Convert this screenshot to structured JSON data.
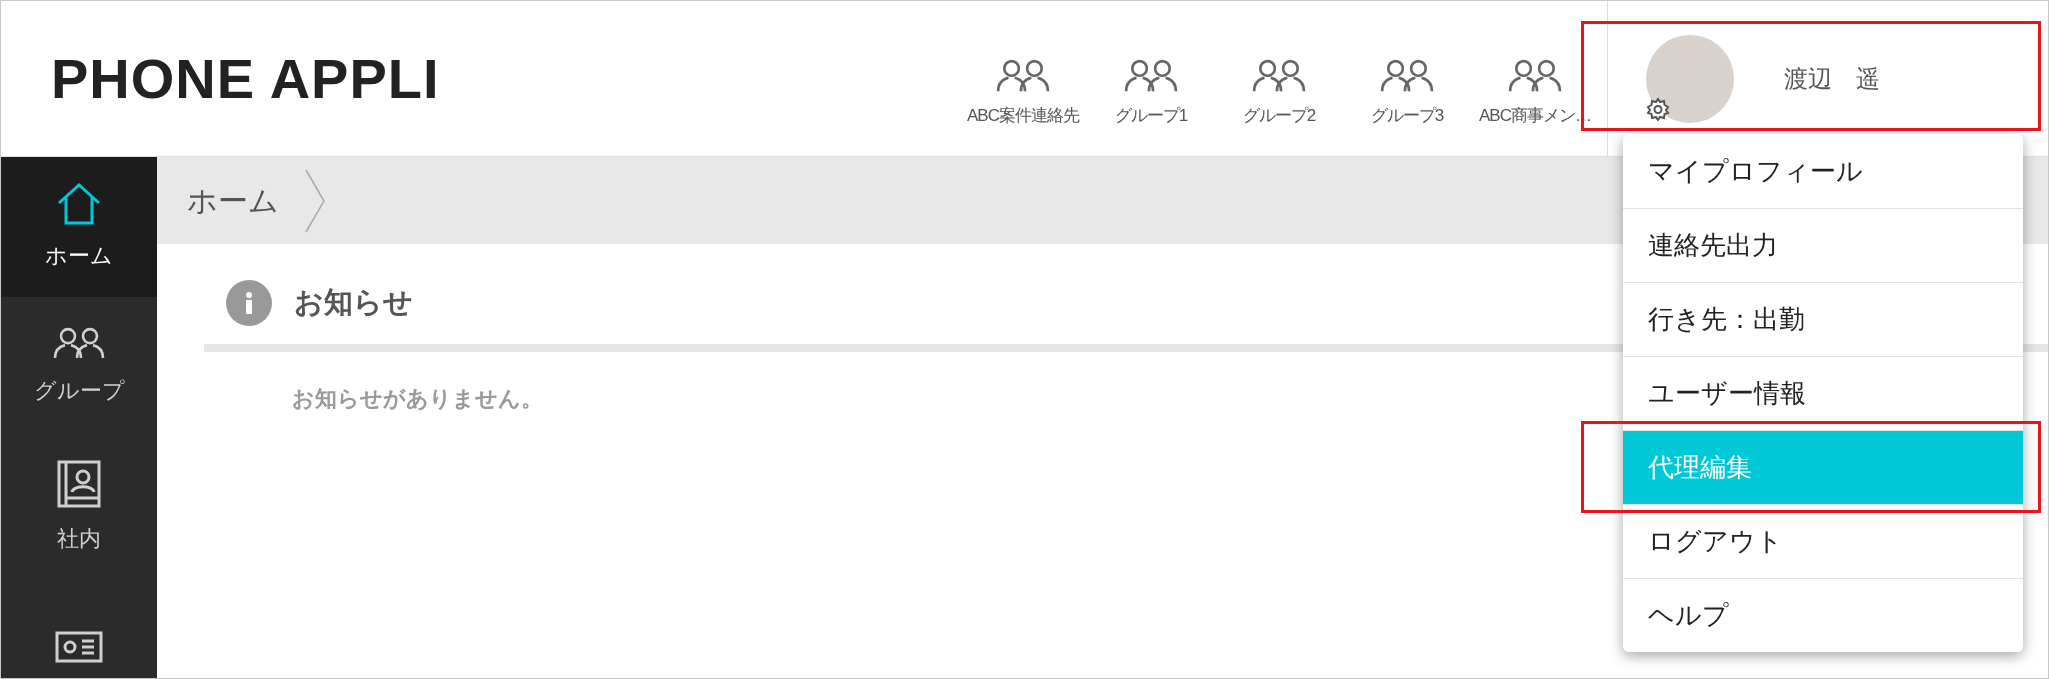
{
  "logo": "PHONE APPLI",
  "groups": [
    {
      "label": "ABC案件連絡先"
    },
    {
      "label": "グループ1"
    },
    {
      "label": "グループ2"
    },
    {
      "label": "グループ3"
    },
    {
      "label": "ABC商事メン…"
    }
  ],
  "user": {
    "name": "渡辺　遥"
  },
  "sidebar": {
    "items": [
      {
        "kind": "home",
        "label": "ホーム",
        "selected": true
      },
      {
        "kind": "group",
        "label": "グループ",
        "selected": false
      },
      {
        "kind": "directory",
        "label": "社内",
        "selected": false
      },
      {
        "kind": "card",
        "selected": false
      }
    ]
  },
  "breadcrumb": [
    "ホーム"
  ],
  "notice": {
    "title": "お知らせ",
    "message": "お知らせがありません。"
  },
  "user_menu": {
    "items": [
      {
        "label": "マイプロフィール",
        "selected": false
      },
      {
        "label": "連絡先出力",
        "selected": false
      },
      {
        "label": "行き先：出勤",
        "selected": false
      },
      {
        "label": "ユーザー情報",
        "selected": false
      },
      {
        "label": "代理編集",
        "selected": true
      },
      {
        "label": "ログアウト",
        "selected": false
      },
      {
        "label": "ヘルプ",
        "selected": false
      }
    ]
  }
}
